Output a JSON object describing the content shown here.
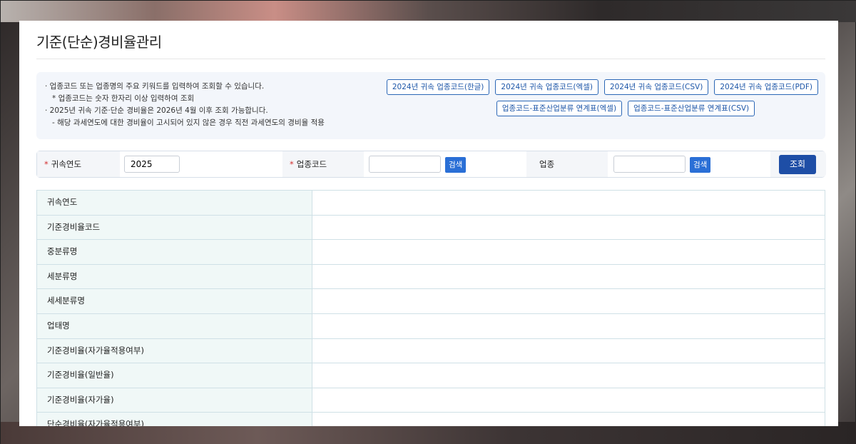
{
  "page": {
    "title": "기준(단순)경비율관리"
  },
  "notice": {
    "lines": [
      "· 업종코드 또는 업종명의 주요 키워드를 입력하여 조회할 수 있습니다.",
      "* 업종코드는 숫자 한자리 이상 입력하여 조회",
      "· 2025년 귀속 기준·단순 경비율은 2026년 4월 이후 조회 가능합니다.",
      "- 해당 과세연도에 대한 경비율이 고시되어 있지 않은 경우 직전 과세연도의 경비율 적용"
    ],
    "downloads_row1": [
      "2024년 귀속 업종코드(한글)",
      "2024년 귀속 업종코드(엑셀)",
      "2024년 귀속 업종코드(CSV)",
      "2024년 귀속 업종코드(PDF)"
    ],
    "downloads_row2": [
      "업종코드-표준산업분류 연계표(엑셀)",
      "업종코드-표준산업분류 연계표(CSV)"
    ]
  },
  "search": {
    "year_label": "귀속연도",
    "year_value": "2025",
    "code_label": "업종코드",
    "code_value": "",
    "code_search": "검색",
    "industry_label": "업종",
    "industry_value": "",
    "industry_search": "검색",
    "submit": "조회",
    "required_mark": "*"
  },
  "table": {
    "rows": [
      "귀속연도",
      "기준경비율코드",
      "중분류명",
      "세분류명",
      "세세분류명",
      "업태명",
      "기준경비율(자가율적용여부)",
      "기준경비율(일반율)",
      "기준경비율(자가율)",
      "단순경비율(자가율적용여부)"
    ]
  }
}
